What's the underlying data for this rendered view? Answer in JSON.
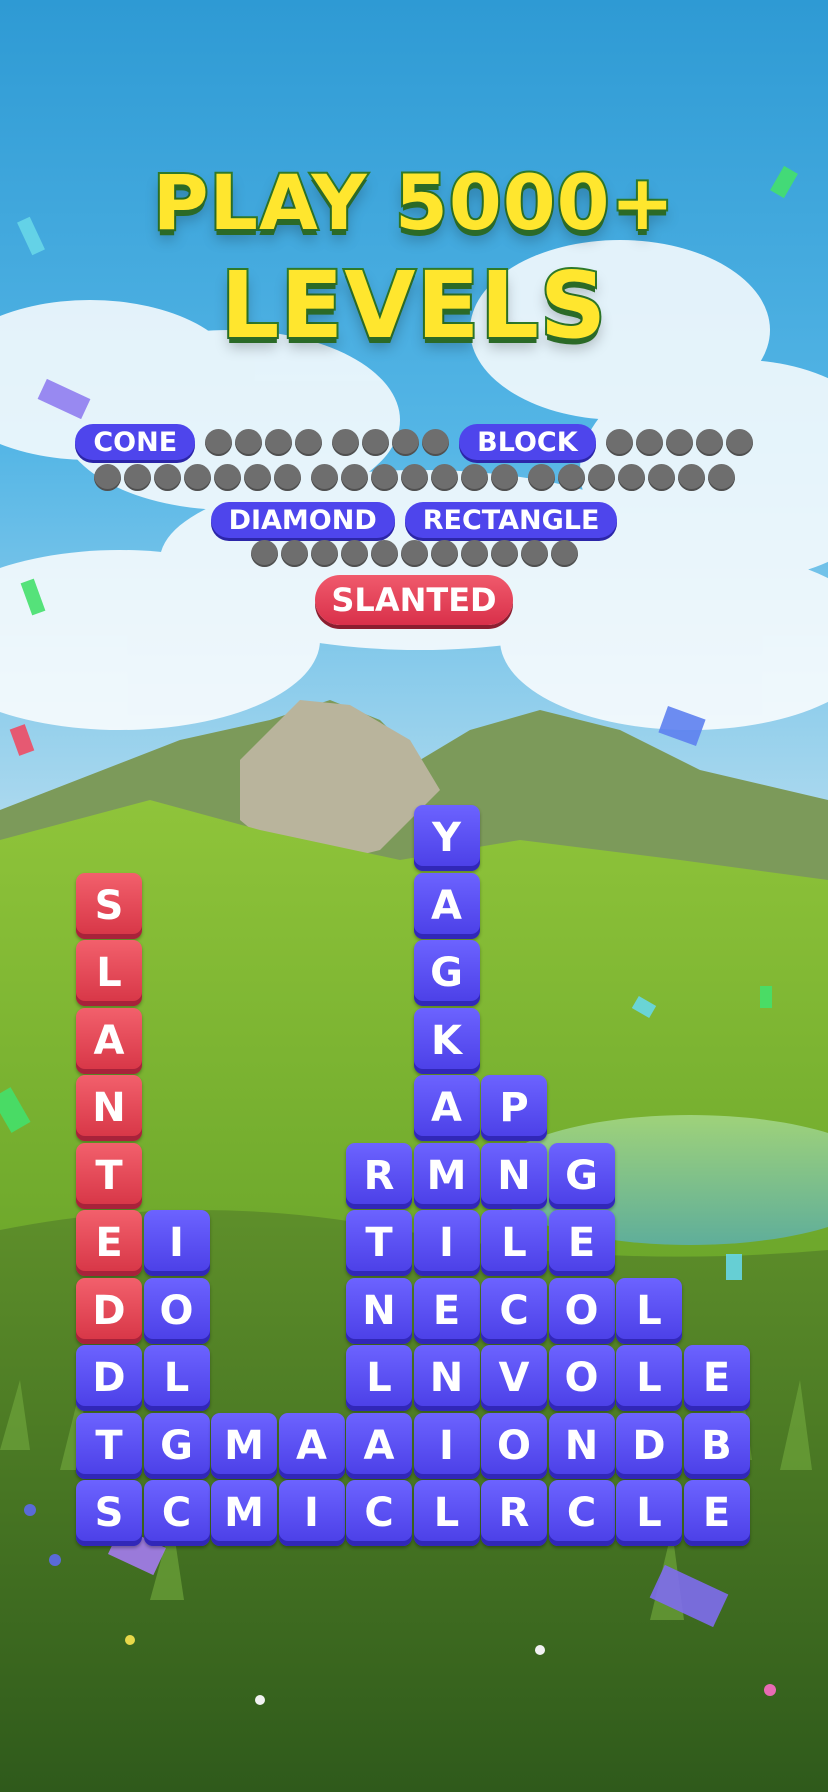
{
  "title": {
    "line1": "PLAY 5000+",
    "line2": "LEVELS"
  },
  "word_rows": [
    [
      {
        "type": "word",
        "text": "CONE"
      },
      {
        "type": "hidden",
        "length": 4
      },
      {
        "type": "hidden",
        "length": 4
      },
      {
        "type": "word",
        "text": "BLOCK"
      },
      {
        "type": "hidden",
        "length": 5
      }
    ],
    [
      {
        "type": "hidden",
        "length": 7
      },
      {
        "type": "hidden",
        "length": 7
      },
      {
        "type": "hidden",
        "length": 7
      }
    ],
    [
      {
        "type": "word",
        "text": "DIAMOND"
      },
      {
        "type": "word",
        "text": "RECTANGLE"
      }
    ],
    [
      {
        "type": "hidden",
        "length": 11
      }
    ],
    [
      {
        "type": "current",
        "text": "SLANTED"
      }
    ]
  ],
  "board": {
    "columns": [
      [
        "S",
        "L",
        "A",
        "N",
        "T",
        "E",
        "D",
        "D",
        "T",
        "S"
      ],
      [
        "I",
        "O",
        "L",
        "G",
        "C"
      ],
      [
        "M",
        "M"
      ],
      [
        "A",
        "I"
      ],
      [
        "R",
        "T",
        "N",
        "L",
        "A",
        "C"
      ],
      [
        "Y",
        "A",
        "G",
        "K",
        "A",
        "M",
        "I",
        "E",
        "N",
        "I",
        "L"
      ],
      [
        "P",
        "N",
        "L",
        "C",
        "V",
        "O",
        "R"
      ],
      [
        "G",
        "E",
        "O",
        "O",
        "N",
        "C"
      ],
      [
        "L",
        "L",
        "D",
        "L"
      ],
      [
        "E",
        "B",
        "E"
      ]
    ],
    "highlight": {
      "column": 0,
      "count": 7,
      "color": "#e23c50"
    },
    "tile_color": "#4e45ec"
  },
  "colors": {
    "title_fill": "#ffe62e",
    "title_outline": "#2f7b2a",
    "hidden_dot": "#6e6e6e"
  }
}
